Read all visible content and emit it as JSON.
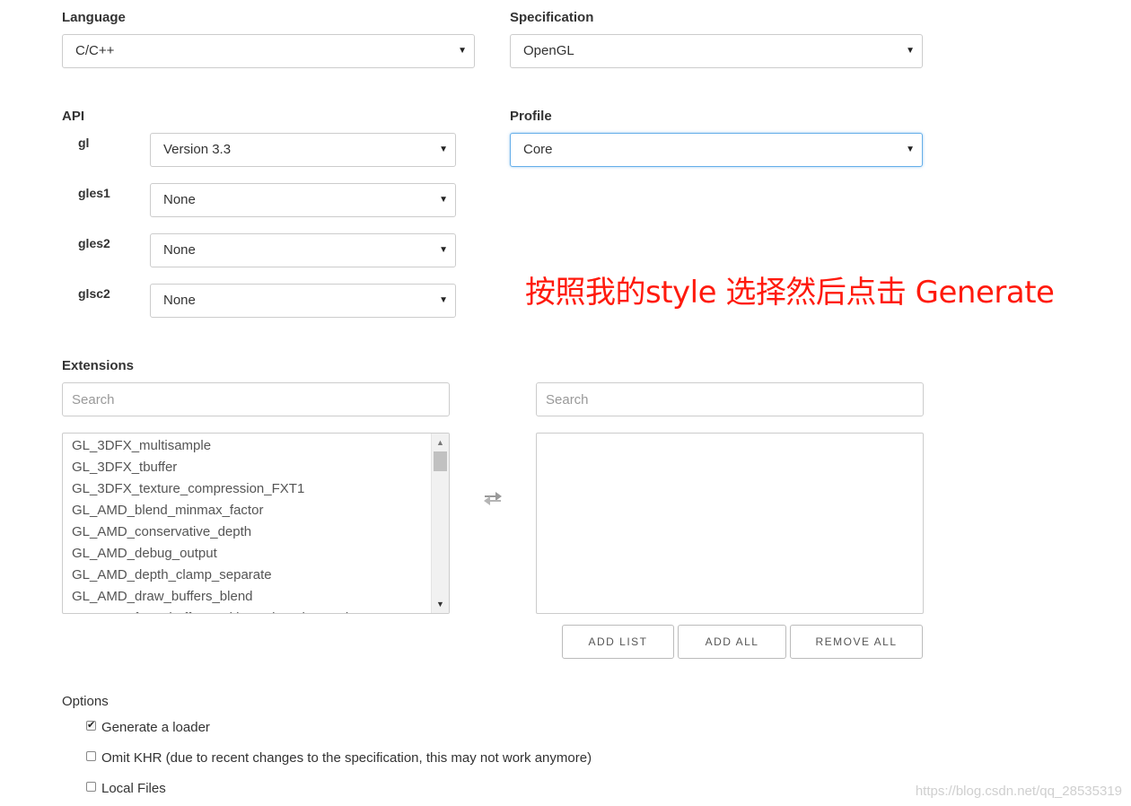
{
  "language": {
    "label": "Language",
    "value": "C/C++"
  },
  "specification": {
    "label": "Specification",
    "value": "OpenGL"
  },
  "api": {
    "label": "API",
    "rows": [
      {
        "name": "gl",
        "value": "Version 3.3"
      },
      {
        "name": "gles1",
        "value": "None"
      },
      {
        "name": "gles2",
        "value": "None"
      },
      {
        "name": "glsc2",
        "value": "None"
      }
    ]
  },
  "profile": {
    "label": "Profile",
    "value": "Core"
  },
  "annotation": "按照我的style 选择然后点击 Generate",
  "extensions": {
    "label": "Extensions",
    "left_search_placeholder": "Search",
    "right_search_placeholder": "Search",
    "available": [
      "GL_3DFX_multisample",
      "GL_3DFX_tbuffer",
      "GL_3DFX_texture_compression_FXT1",
      "GL_AMD_blend_minmax_factor",
      "GL_AMD_conservative_depth",
      "GL_AMD_debug_output",
      "GL_AMD_depth_clamp_separate",
      "GL_AMD_draw_buffers_blend",
      "GL_AMD_framebuffer_multisample_advanced"
    ],
    "selected": [],
    "buttons": {
      "add_list": "ADD LIST",
      "add_all": "ADD ALL",
      "remove_all": "REMOVE ALL"
    }
  },
  "options": {
    "label": "Options",
    "items": [
      {
        "label": "Generate a loader",
        "checked": true
      },
      {
        "label": "Omit KHR (due to recent changes to the specification, this may not work anymore)",
        "checked": false
      },
      {
        "label": "Local Files",
        "checked": false
      }
    ]
  },
  "watermark": "https://blog.csdn.net/qq_28535319",
  "colors": {
    "annotation": "#ff1a0d",
    "focus_border": "#66afe9"
  },
  "icons": {
    "caret": "caret-down-icon",
    "swap": "swap-arrows-icon",
    "checkbox": "check-icon"
  }
}
